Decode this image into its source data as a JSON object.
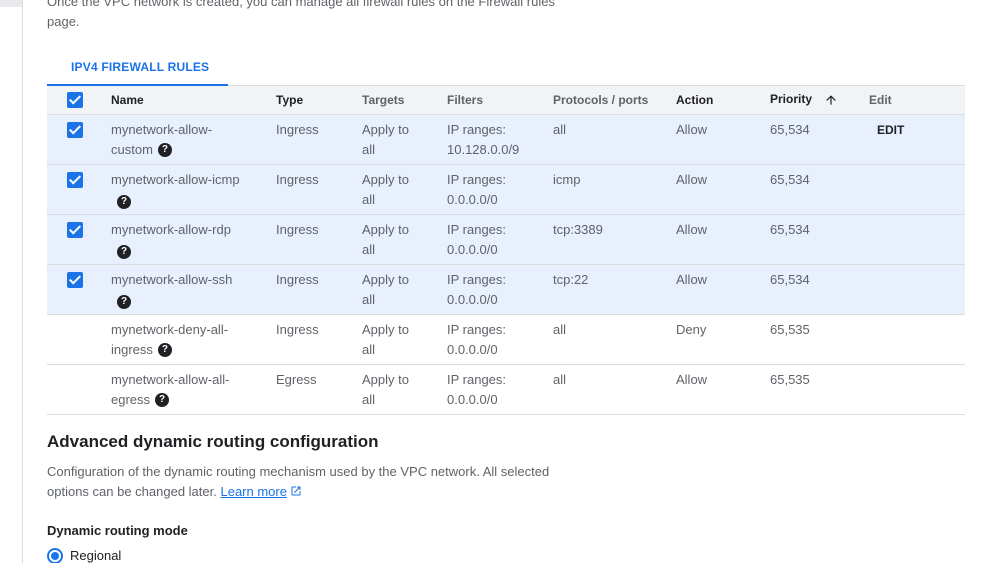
{
  "intro": {
    "text": "Once the VPC network is created, you can manage all firewall rules on the Firewall rules page."
  },
  "tabs": [
    {
      "label": "IPV4 FIREWALL RULES",
      "active": true
    }
  ],
  "table": {
    "columns": {
      "name": "Name",
      "type": "Type",
      "targets": "Targets",
      "filters": "Filters",
      "protocols": "Protocols / ports",
      "action": "Action",
      "priority": "Priority",
      "edit": "Edit"
    },
    "sort_icon": "arrow-upward-icon",
    "edit_label": "EDIT",
    "rows": [
      {
        "selected": true,
        "name": "mynetwork-allow-custom",
        "type": "Ingress",
        "targets": "Apply to all",
        "filters_label": "IP ranges:",
        "filters_value": "10.128.0.0/9",
        "protocols": "all",
        "action": "Allow",
        "priority": "65,534"
      },
      {
        "selected": true,
        "name": "mynetwork-allow-icmp",
        "type": "Ingress",
        "targets": "Apply to all",
        "filters_label": "IP ranges:",
        "filters_value": "0.0.0.0/0",
        "protocols": "icmp",
        "action": "Allow",
        "priority": "65,534"
      },
      {
        "selected": true,
        "name": "mynetwork-allow-rdp",
        "type": "Ingress",
        "targets": "Apply to all",
        "filters_label": "IP ranges:",
        "filters_value": "0.0.0.0/0",
        "protocols": "tcp:3389",
        "action": "Allow",
        "priority": "65,534"
      },
      {
        "selected": true,
        "name": "mynetwork-allow-ssh",
        "type": "Ingress",
        "targets": "Apply to all",
        "filters_label": "IP ranges:",
        "filters_value": "0.0.0.0/0",
        "protocols": "tcp:22",
        "action": "Allow",
        "priority": "65,534"
      },
      {
        "selected": false,
        "name": "mynetwork-deny-all-ingress",
        "type": "Ingress",
        "targets": "Apply to all",
        "filters_label": "IP ranges:",
        "filters_value": "0.0.0.0/0",
        "protocols": "all",
        "action": "Deny",
        "priority": "65,535"
      },
      {
        "selected": false,
        "name": "mynetwork-allow-all-egress",
        "type": "Egress",
        "targets": "Apply to all",
        "filters_label": "IP ranges:",
        "filters_value": "0.0.0.0/0",
        "protocols": "all",
        "action": "Allow",
        "priority": "65,535"
      }
    ]
  },
  "routing": {
    "title": "Advanced dynamic routing configuration",
    "description": "Configuration of the dynamic routing mechanism used by the VPC network. All selected options can be changed later.",
    "learn_more": "Learn more",
    "mode_label": "Dynamic routing mode",
    "option_regional": "Regional"
  },
  "colors": {
    "accent": "#1a73e8",
    "selected_row": "#e8f0fe",
    "header_bg": "#f1f3f4",
    "divider": "#dadce0"
  }
}
